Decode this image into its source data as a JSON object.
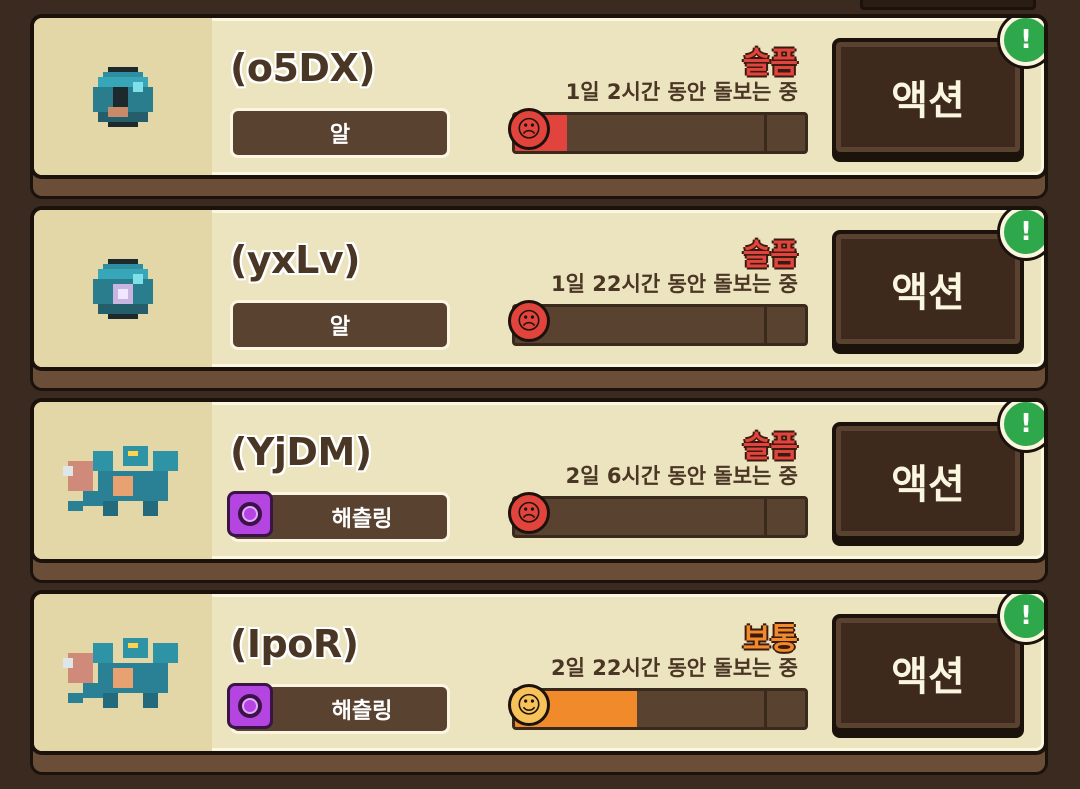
{
  "pets": [
    {
      "name": "(o5DX)",
      "stage": "알",
      "mood": "슬픔",
      "mood_color": "#e0443c",
      "care_time": "1일 2시간 동안 돌보는 중",
      "happiness": 0.18,
      "face_icon": "sad-face-icon",
      "action_label": "액션",
      "alert_symbol": "!"
    },
    {
      "name": "(yxLv)",
      "stage": "알",
      "mood": "슬픔",
      "mood_color": "#e0443c",
      "care_time": "1일 22시간 동안 돌보는 중",
      "happiness": 0.0,
      "face_icon": "sad-face-icon",
      "action_label": "액션",
      "alert_symbol": "!"
    },
    {
      "name": "(YjDM)",
      "stage": "해츨링",
      "mood": "슬픔",
      "mood_color": "#e0443c",
      "care_time": "2일 6시간 동안 돌보는 중",
      "happiness": 0.0,
      "face_icon": "sad-face-icon",
      "action_label": "액션",
      "alert_symbol": "!"
    },
    {
      "name": "(IpoR)",
      "stage": "해츨링",
      "mood": "보통",
      "mood_color": "#f08a2a",
      "care_time": "2일 22시간 동안 돌보는 중",
      "happiness": 0.42,
      "face_icon": "neutral-face-icon",
      "action_label": "액션",
      "alert_symbol": "!"
    }
  ]
}
